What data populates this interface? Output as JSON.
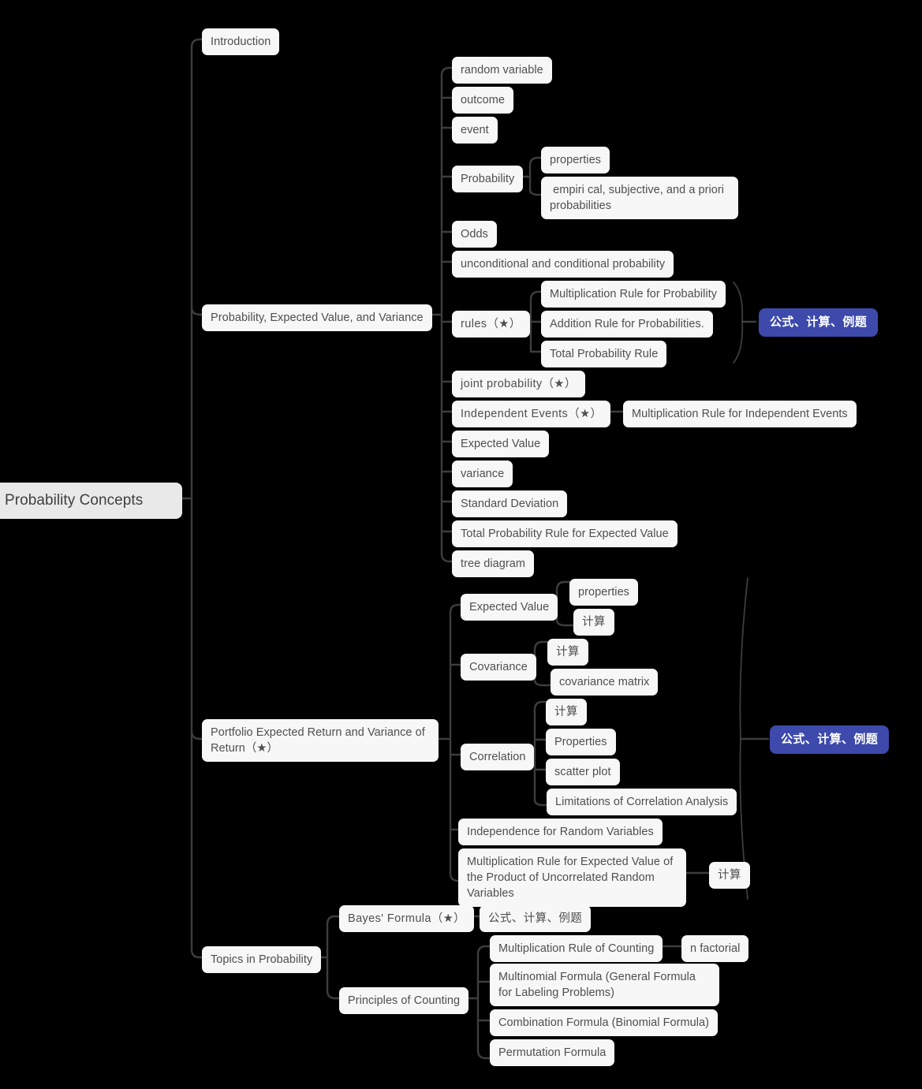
{
  "diagram": {
    "type": "mindmap",
    "title": "Probability Concepts",
    "background_color": "#000000",
    "node_color": "#f7f7f7",
    "root_color": "#e9e9e9",
    "text_color": "#4f4f4f",
    "badge_color": "#3d4aab",
    "badge_text_color": "#ffffff",
    "edge_color": "#3d3d3d"
  },
  "nodes": {
    "root": "Probability Concepts",
    "introduction": "Introduction",
    "branch_pev": "Probability, Expected Value, and Variance",
    "random_variable": "random variable",
    "outcome": "outcome",
    "event": "event",
    "probability": "Probability",
    "probability_properties": "properties",
    "probability_kinds": " empiri cal, subjective, and a priori probabilities",
    "odds": "Odds",
    "uncond_cond": "unconditional and conditional probability",
    "rules": "rules（★）",
    "rule_multiplication": "Multiplication Rule for Probability",
    "rule_addition": "Addition Rule for Probabilities.",
    "rule_total": "Total Probability Rule",
    "badge_rules": "公式、计算、例题",
    "joint_probability": "joint probability（★）",
    "independent_events": "Independent Events（★）",
    "mult_rule_independent": "Multiplication Rule for Independent Events",
    "expected_value": "Expected Value",
    "variance": "variance",
    "standard_deviation": "Standard Deviation",
    "total_prob_rule_ev": "Total Probability Rule for Expected Value",
    "tree_diagram": "tree diagram",
    "branch_portfolio": "Portfolio Expected Return and Variance of Return（★）",
    "p_expected_value": "Expected Value",
    "p_ev_properties": "properties",
    "p_ev_calc": "计算",
    "covariance": "Covariance",
    "cov_calc": "计算",
    "covariance_matrix": "covariance matrix",
    "correlation": "Correlation",
    "corr_calc": "计算",
    "corr_properties": "Properties",
    "scatter_plot": "scatter plot",
    "limitations_corr": "Limitations of Correlation Analysis",
    "independence_rv": "Independence for Random Variables",
    "mult_rule_uncorrelated": "Multiplication Rule for Expected Value of the Product of Uncorrelated Random Variables",
    "mult_rule_uncorrelated_calc": "计算",
    "badge_portfolio": "公式、计算、例题",
    "branch_topics": "Topics in Probability",
    "bayes_formula": "Bayes' Formula（★）",
    "bayes_note": "公式、计算、例题",
    "principles_counting": "Principles of Counting",
    "mult_rule_counting": "Multiplication Rule of Counting",
    "n_factorial": "n factorial",
    "multinomial_formula": "Multinomial Formula (General Formula for Labeling Problems)",
    "combination_formula": "Combination Formula (Binomial Formula)",
    "permutation_formula": "Permutation Formula"
  }
}
